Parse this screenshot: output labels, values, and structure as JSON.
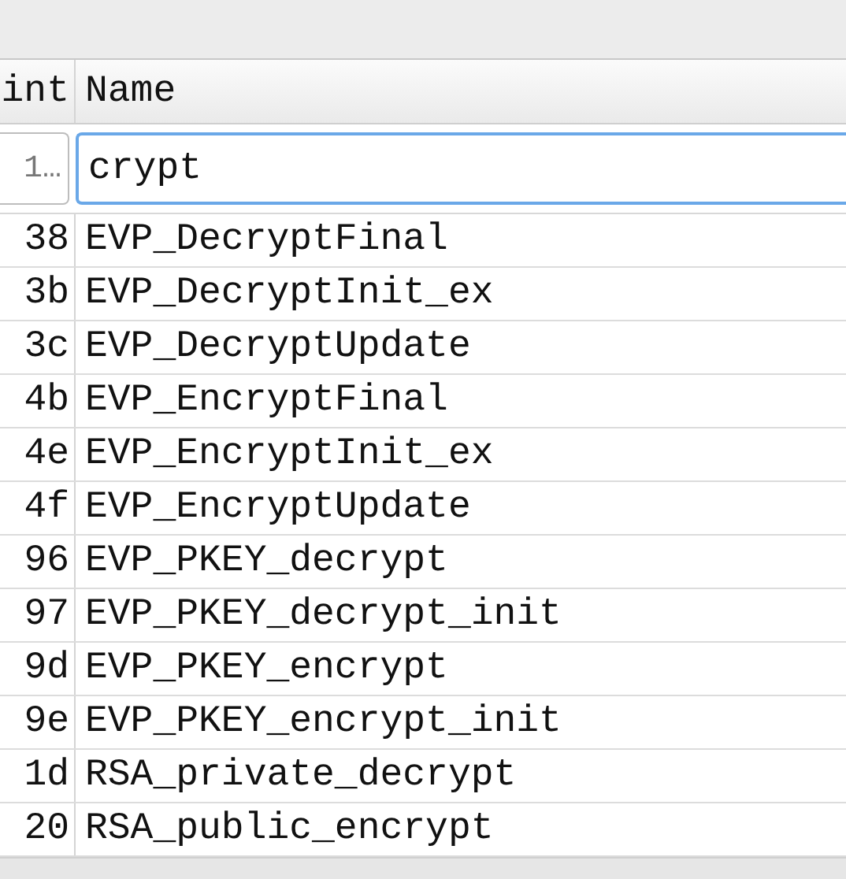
{
  "table": {
    "columns": [
      {
        "label": "int"
      },
      {
        "label": "Name"
      }
    ],
    "filter": {
      "column_1": "1…",
      "name": "crypt"
    },
    "rows": [
      {
        "column_1": "38",
        "name": "EVP_DecryptFinal"
      },
      {
        "column_1": "3b",
        "name": "EVP_DecryptInit_ex"
      },
      {
        "column_1": "3c",
        "name": "EVP_DecryptUpdate"
      },
      {
        "column_1": "4b",
        "name": "EVP_EncryptFinal"
      },
      {
        "column_1": "4e",
        "name": "EVP_EncryptInit_ex"
      },
      {
        "column_1": "4f",
        "name": "EVP_EncryptUpdate"
      },
      {
        "column_1": "96",
        "name": "EVP_PKEY_decrypt"
      },
      {
        "column_1": "97",
        "name": "EVP_PKEY_decrypt_init"
      },
      {
        "column_1": "9d",
        "name": "EVP_PKEY_encrypt"
      },
      {
        "column_1": "9e",
        "name": "EVP_PKEY_encrypt_init"
      },
      {
        "column_1": "1d",
        "name": "RSA_private_decrypt"
      },
      {
        "column_1": "20",
        "name": "RSA_public_encrypt"
      }
    ]
  }
}
